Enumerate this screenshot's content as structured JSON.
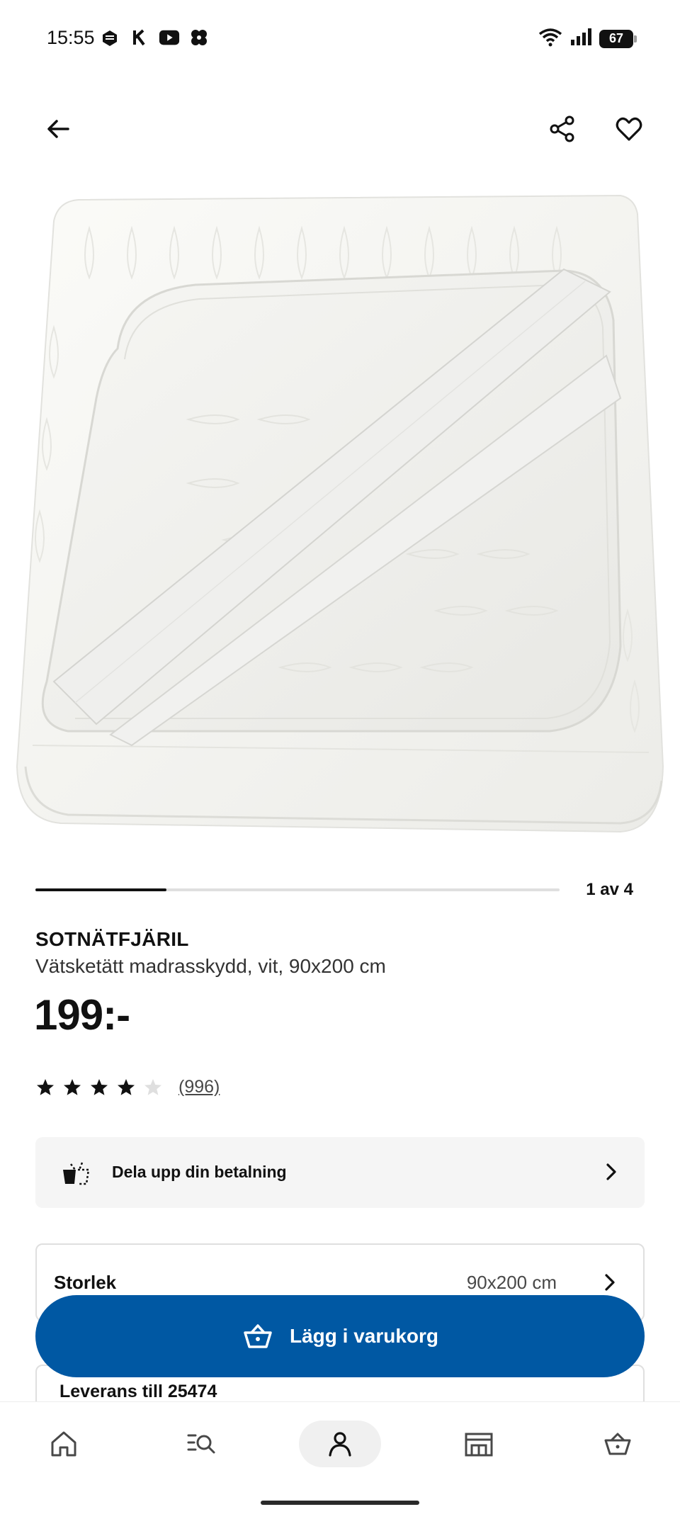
{
  "status_bar": {
    "time": "15:55",
    "battery": "67"
  },
  "top_nav": {
    "back_icon": "arrow-left-icon",
    "share_icon": "share-icon",
    "favorite_icon": "heart-icon"
  },
  "carousel": {
    "counter": "1 av 4",
    "progress": 0.25
  },
  "product": {
    "name": "SOTNÄTFJÄRIL",
    "description": "Vätsketätt madrasskydd, vit, 90x200 cm",
    "price": "199:-",
    "rating_stars": 4,
    "rating_max": 5,
    "rating_count": "(996)"
  },
  "payment": {
    "label": "Dela upp din betalning",
    "icon": "basket-split-icon"
  },
  "size": {
    "label": "Storlek",
    "value": "90x200 cm"
  },
  "delivery": {
    "label": "Leverans till 25474"
  },
  "cart_button": {
    "label": "Lägg i varukorg",
    "icon": "cart-icon"
  },
  "bottom_nav": {
    "items": [
      {
        "icon": "home-icon",
        "active": false
      },
      {
        "icon": "search-list-icon",
        "active": false
      },
      {
        "icon": "profile-icon",
        "active": true
      },
      {
        "icon": "store-icon",
        "active": false
      },
      {
        "icon": "cart-icon",
        "active": false
      }
    ]
  },
  "colors": {
    "accent": "#0058a3",
    "text": "#111111",
    "muted": "#484848",
    "card_bg": "#f5f5f5",
    "border": "#dfdfdf"
  }
}
